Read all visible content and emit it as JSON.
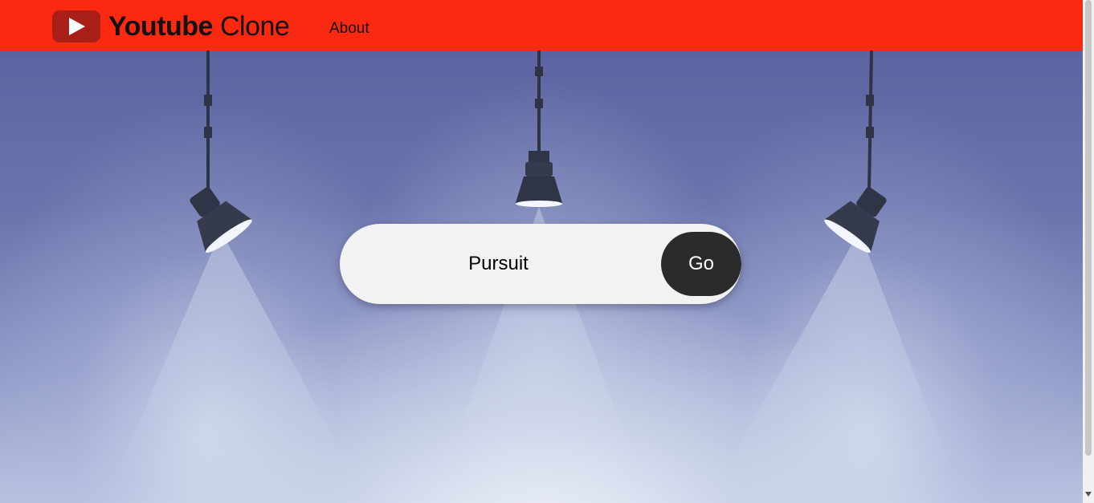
{
  "header": {
    "logo_bold": "Youtube",
    "logo_light": "Clone",
    "logo_icon": "play-icon",
    "about_label": "About",
    "background_color": "#fb2910"
  },
  "search": {
    "value": "Pursuit",
    "button_label": "Go"
  },
  "hero": {
    "background_description_icon": "spotlights-background"
  }
}
